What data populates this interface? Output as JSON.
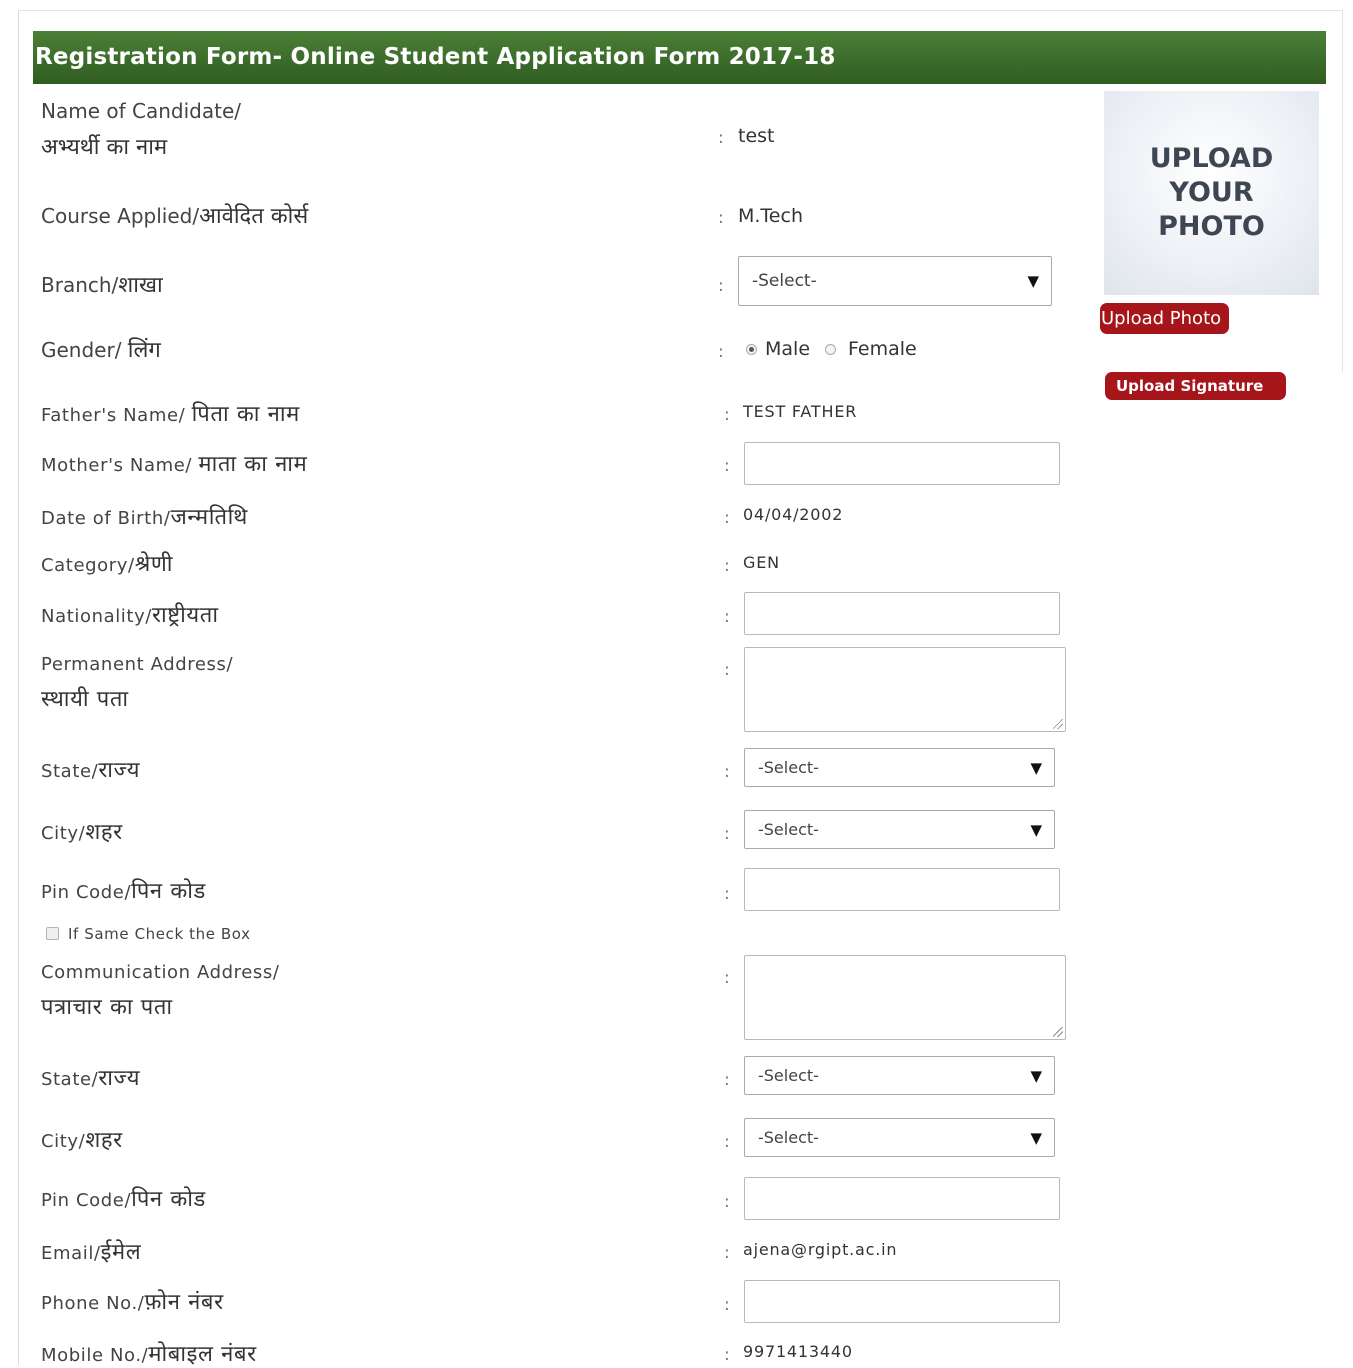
{
  "header": {
    "title": "Registration Form- Online Student Application Form 2017-18"
  },
  "photo": {
    "placeholder_text": "UPLOAD YOUR PHOTO",
    "upload_photo_label": "Upload Photo",
    "upload_signature_label": "Upload Signature"
  },
  "colon": ":",
  "fields": {
    "name": {
      "label_en": "Name of Candidate/",
      "label_hi": "अभ्यर्थी का नाम",
      "value": "test"
    },
    "course": {
      "label_en": "Course Applied/",
      "label_hi": "आवेदित कोर्स",
      "value": "M.Tech"
    },
    "branch": {
      "label_en": "Branch/",
      "label_hi": "शाखा",
      "selected": "-Select-"
    },
    "gender": {
      "label_en": "Gender/ ",
      "label_hi": "लिंग",
      "options": [
        "Male",
        "Female"
      ],
      "selected": "Male"
    },
    "father": {
      "label_en": "Father's Name/ ",
      "label_hi": "पिता का नाम",
      "value": "TEST FATHER"
    },
    "mother": {
      "label_en": "Mother's Name/ ",
      "label_hi": "माता का नाम",
      "value": ""
    },
    "dob": {
      "label_en": "Date of Birth/",
      "label_hi": "जन्मतिथि",
      "value": "04/04/2002"
    },
    "category": {
      "label_en": "Category/",
      "label_hi": "श्रेणी",
      "value": "GEN"
    },
    "nationality": {
      "label_en": "Nationality/",
      "label_hi": "राष्ट्रीयता",
      "value": ""
    },
    "perm_address": {
      "label_en": "Permanent Address/",
      "label_hi": "स्थायी पता",
      "value": ""
    },
    "perm_state": {
      "label_en": "State/",
      "label_hi": "राज्य",
      "selected": "-Select-"
    },
    "perm_city": {
      "label_en": "City/",
      "label_hi": "शहर",
      "selected": "-Select-"
    },
    "perm_pin": {
      "label_en": "Pin Code/",
      "label_hi": "पिन कोड",
      "value": ""
    },
    "same_check": {
      "label": "If Same Check the Box",
      "checked": false
    },
    "comm_address": {
      "label_en": "Communication Address/",
      "label_hi": "पत्राचार का पता",
      "value": ""
    },
    "comm_state": {
      "label_en": "State/",
      "label_hi": "राज्य",
      "selected": "-Select-"
    },
    "comm_city": {
      "label_en": "City/",
      "label_hi": "शहर",
      "selected": "-Select-"
    },
    "comm_pin": {
      "label_en": "Pin Code/",
      "label_hi": "पिन कोड",
      "value": ""
    },
    "email": {
      "label_en": "Email/",
      "label_hi": "ईमेल",
      "value": "ajena@rgipt.ac.in"
    },
    "phone": {
      "label_en": "Phone No./",
      "label_hi": "फ़ोन नंबर",
      "value": ""
    },
    "mobile": {
      "label_en": "Mobile No./",
      "label_hi": "मोबाइल नंबर",
      "value": "9971413440"
    }
  },
  "colors": {
    "header_green": "#3a6b2a",
    "button_red": "#a5151a"
  }
}
